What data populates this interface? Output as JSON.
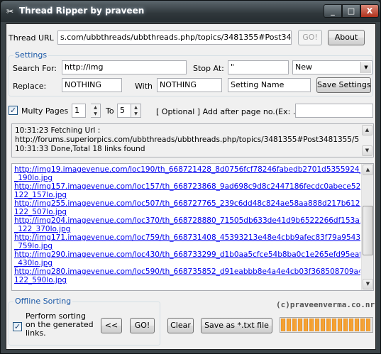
{
  "window": {
    "title": "Thread Ripper by praveen",
    "app_icon": "scissors-icon",
    "controls": {
      "minimize": "_",
      "maximize": "□",
      "close": "X"
    }
  },
  "url_row": {
    "label": "Thread URL",
    "value": "s.com/ubbthreads/ubbthreads.php/topics/3481355#Post3481355/",
    "go_label": "GO!",
    "about_label": "About"
  },
  "settings": {
    "caption": "Settings",
    "search_label": "Search For:",
    "search_value": "http://img",
    "stop_label": "Stop At:",
    "stop_value": "\"",
    "preset_value": "New",
    "replace_label": "Replace:",
    "replace_value": "NOTHING",
    "with_label": "With",
    "with_value": "NOTHING",
    "setting_name_value": "Setting Name",
    "save_settings_label": "Save Settings"
  },
  "pages": {
    "multy_label": "Multy Pages",
    "multy_checked": true,
    "from_value": "1",
    "to_label": "To",
    "to_value": "5",
    "optional_label": "[ Optional ] Add after page no.(Ex: .htm)",
    "suffix_value": ""
  },
  "log": {
    "lines": [
      "10:31:23 Fetching Url :",
      "http://forums.superiorpics.com/ubbthreads/ubbthreads.php/topics/3481355#Post3481355/5",
      "10:31:33 Done,Total 18 links found"
    ]
  },
  "links": {
    "lines": [
      "http://img19.imagevenue.com/loc190/th_668721428_8d0756fcf78246fabedb2701d5355924_7_122",
      "_190lo.jpg",
      "http://img157.imagevenue.com/loc157/th_668723868_9ad698c9d8c2447186fecdc0abece52e_7_",
      "122_157lo.jpg",
      "http://img255.imagevenue.com/loc507/th_668727765_239c6dd48c824ae58aa888d217b61226_7_",
      "122_507lo.jpg",
      "http://img204.imagevenue.com/loc370/th_668728880_71505db633de41d9b6522266df153a35_7",
      "_122_370lo.jpg",
      "http://img171.imagevenue.com/loc759/th_668731408_45393213e48e4cbb9afec83f79a95438_7_122",
      "_759lo.jpg",
      "http://img290.imagevenue.com/loc430/th_668733299_d1b0aa5cfce54b8ba0c1e265efd95eaf_7_122",
      "_430lo.jpg",
      "http://img280.imagevenue.com/loc590/th_668735852_d91eabbb8e4a4e4cb03f368508709a4a_7_",
      "122_590lo.jpg"
    ]
  },
  "offline": {
    "caption": "Offline Sorting",
    "sort_label_1": "Perform sorting",
    "sort_label_2": "on the generated",
    "sort_label_3": "links.",
    "sort_checked": true,
    "back_label": "<<",
    "go_label": "GO!"
  },
  "bottom": {
    "clear_label": "Clear",
    "save_txt_label": "Save as *.txt file",
    "credit": "(c)praveenverma.co.nr",
    "progress_percent": 100
  },
  "colors": {
    "accent": "#1c5aa8",
    "link": "#0000ee",
    "progress": "#f09a2a"
  }
}
